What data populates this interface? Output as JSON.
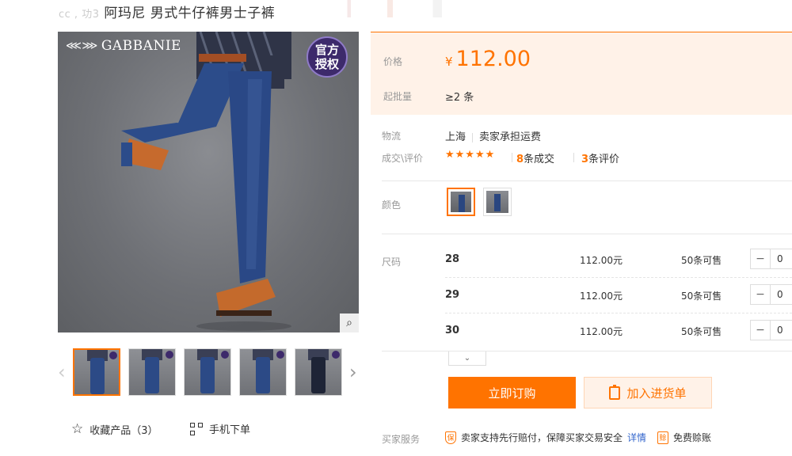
{
  "title": {
    "prefix_blurred": "cc  ,  功3",
    "text": "阿玛尼 男式牛仔裤男士子裤"
  },
  "gallery": {
    "brand_logo": "GABBANIE",
    "badge": "官方\n授权",
    "zoom_icon": "magnifier-icon",
    "thumb_count": 5
  },
  "actions": {
    "favorite": "收藏产品（3）",
    "mobile_order": "手机下单"
  },
  "price": {
    "label": "价格",
    "currency": "¥",
    "amount": "112.00",
    "batch_label": "起批量",
    "batch_value": "≥2 条"
  },
  "logistics": {
    "label": "物流",
    "from": "上海",
    "shipping": "卖家承担运费"
  },
  "trade": {
    "label": "成交\\评价",
    "rating": 5,
    "deals_count": "8",
    "deals_suffix": "条成交",
    "reviews_count": "3",
    "reviews_suffix": "条评价"
  },
  "color": {
    "label": "颜色"
  },
  "sizes": {
    "label": "尺码",
    "rows": [
      {
        "size": "28",
        "price": "112.00元",
        "stock": "50条可售",
        "qty": "0"
      },
      {
        "size": "29",
        "price": "112.00元",
        "stock": "50条可售",
        "qty": "0"
      },
      {
        "size": "30",
        "price": "112.00元",
        "stock": "50条可售",
        "qty": "0"
      }
    ]
  },
  "buttons": {
    "buy_now": "立即订购",
    "add_to_cart": "加入进货单"
  },
  "service": {
    "label": "买家服务",
    "guarantee": "卖家支持先行赔付，保障买家交易安全",
    "details_link": "详情",
    "free": "免费赊账"
  },
  "colors": {
    "accent": "#ff7300",
    "price_bg": "#fff2e8",
    "link": "#3366cc"
  }
}
